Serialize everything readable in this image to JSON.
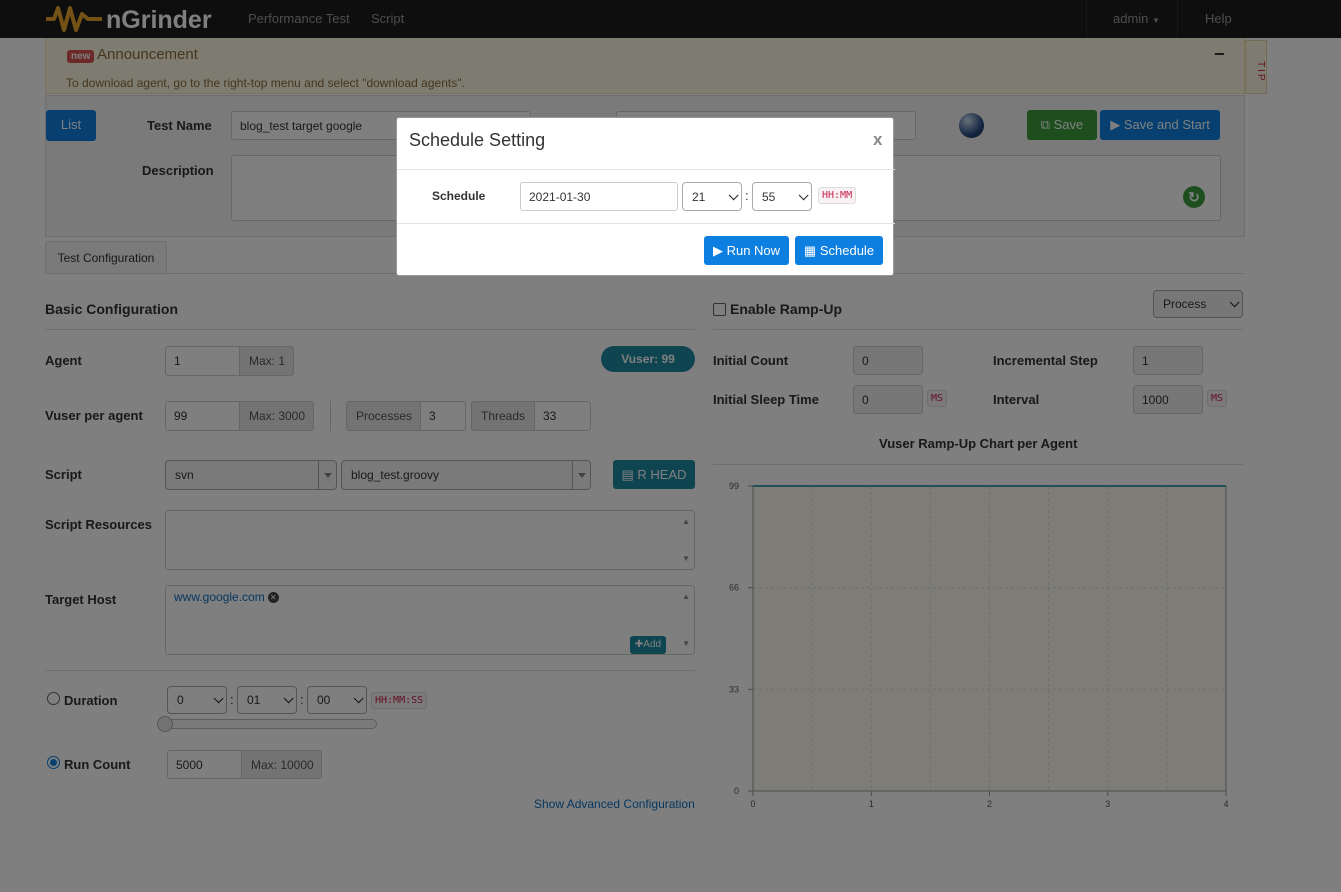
{
  "app": {
    "logo_text": "nGrinder",
    "brand_color": "#e8a42a"
  },
  "nav": {
    "items": [
      "Performance Test",
      "Script"
    ],
    "user": "admin",
    "help": "Help"
  },
  "announcement": {
    "badge": "new",
    "title": "Announcement",
    "text": "To download agent, go to the right-top menu and select \"download agents\".",
    "collapse": "−",
    "tip": "TIP"
  },
  "test_header": {
    "list_label": "List",
    "test_name_label": "Test Name",
    "test_name_value": "blog_test target google",
    "description_label": "Description",
    "save_label": "Save",
    "save_and_start_label": "Save and Start"
  },
  "tabs": [
    "Test Configuration"
  ],
  "basic": {
    "title": "Basic Configuration",
    "agent_label": "Agent",
    "agent_value": "1",
    "agent_max": "Max: 1",
    "vuser_badge": "Vuser: 99",
    "vuser_per_agent_label": "Vuser per agent",
    "vuser_per_agent_value": "99",
    "vuser_max": "Max: 3000",
    "processes_label": "Processes",
    "processes_value": "3",
    "threads_label": "Threads",
    "threads_value": "33",
    "script_label": "Script",
    "script_repo": "svn",
    "script_file": "blog_test.groovy",
    "rhead_label": "R HEAD",
    "resources_label": "Script Resources",
    "target_host_label": "Target Host",
    "target_host": "www.google.com",
    "add_label": "Add",
    "duration_label": "Duration",
    "duration_h": "0",
    "duration_m": "01",
    "duration_s": "00",
    "duration_fmt": "HH:MM:SS",
    "run_count_label": "Run Count",
    "run_count_value": "5000",
    "run_count_max": "Max: 10000",
    "advanced_link": "Show Advanced Configuration"
  },
  "rampup": {
    "enable_label": "Enable Ramp-Up",
    "type_select": "Process",
    "initial_count_label": "Initial Count",
    "initial_count_value": "0",
    "incremental_step_label": "Incremental Step",
    "incremental_step_value": "1",
    "initial_sleep_label": "Initial Sleep Time",
    "initial_sleep_value": "0",
    "ms_unit": "MS",
    "interval_label": "Interval",
    "interval_value": "1000",
    "chart_title": "Vuser Ramp-Up Chart per Agent"
  },
  "chart_data": {
    "type": "line",
    "title": "Vuser Ramp-Up Chart per Agent",
    "x": [
      0,
      1,
      2,
      3,
      4
    ],
    "y_ticks": [
      0,
      33,
      66,
      99
    ],
    "xlim": [
      0,
      4
    ],
    "ylim": [
      0,
      99
    ],
    "series": [
      {
        "values": [
          99,
          99,
          99,
          99,
          99
        ]
      }
    ],
    "line_color": "#4aa3b6",
    "grid": true
  },
  "modal": {
    "title": "Schedule Setting",
    "close": "x",
    "schedule_label": "Schedule",
    "date_value": "2021-01-30",
    "hour_value": "21",
    "minute_value": "55",
    "colon": ":",
    "time_fmt": "HH:MM",
    "run_now_label": "Run Now",
    "schedule_button_label": "Schedule"
  }
}
